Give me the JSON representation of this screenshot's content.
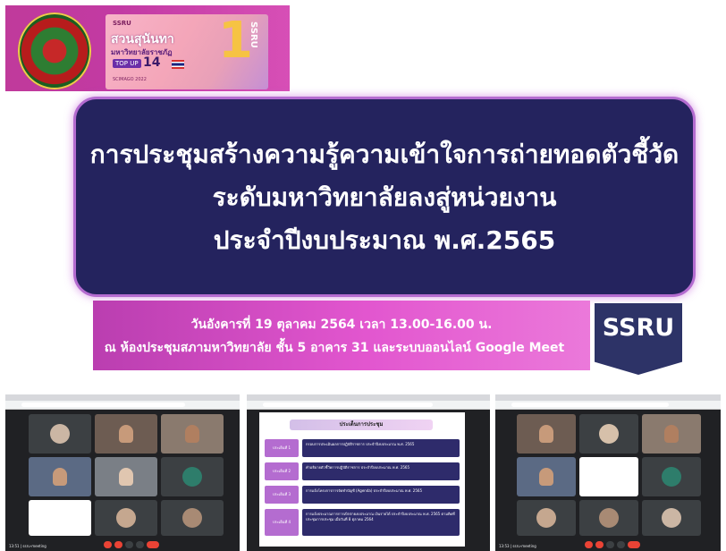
{
  "banner": {
    "brand": "SSRU",
    "title": "สวนสุนันทา",
    "subtitle": "มหาวิทยาลัยราชภัฏ",
    "rank_label": "TOP UP",
    "rank_number": "14",
    "big_rank": "1",
    "side_text": "SSRU",
    "footer": "SCIMAGO 2022"
  },
  "title": {
    "line1": "การประชุมสร้างความรู้ความเข้าใจการถ่ายทอดตัวชี้วัด",
    "line2": "ระดับมหาวิทยาลัยลงสู่หน่วยงาน",
    "line3": "ประจำปีงบประมาณ พ.ศ.2565"
  },
  "info": {
    "date_line": "วันอังคารที่ 19 ตุลาคม 2564 เวลา 13.00-16.00 น.",
    "venue_line": "ณ ห้องประชุมสภามหาวิทยาลัย ชั้น 5 อาคาร 31 และระบบออนไลน์ Google Meet"
  },
  "badge": {
    "text": "SSRU"
  },
  "meet_left": {
    "participants": [
      "",
      "",
      "",
      "",
      "",
      "",
      "",
      "",
      ""
    ],
    "time": "13:51 | ssru-meeting"
  },
  "presentation": {
    "heading": "ประเด็นการประชุม",
    "rows": [
      {
        "label": "ประเด็นที่ 1",
        "text": "กรอบการประเมินผลการปฏิบัติราชการ ประจำปีงบประมาณ พ.ศ. 2565"
      },
      {
        "label": "ประเด็นที่ 2",
        "text": "คำอธิบายตัวชี้วัดการปฏิบัติราชการ ประจำปีงบประมาณ พ.ศ. 2565"
      },
      {
        "label": "ประเด็นที่ 3",
        "text": "การแจ้งโครงการการจัดทำบัญชี (Agenda) ประจำปีงบประมาณ พ.ศ. 2565"
      },
      {
        "label": "ประเด็นที่ 4",
        "text": "การแจ้งประมาณการการเบิกจ่ายงบประมาณ เงินรายได้ ประจำปีงบประมาณ พ.ศ. 2565 ตามติดที่ประชุมการประชุม เมื่อวันที่ 8 ตุลาคม 2564"
      }
    ]
  },
  "meet_right": {
    "time": "13:53 | ssru-meeting"
  },
  "colors": {
    "slide_title_bg": "#24235e",
    "pink_accent": "#c23aa3",
    "badge_bg": "#2d3367"
  }
}
